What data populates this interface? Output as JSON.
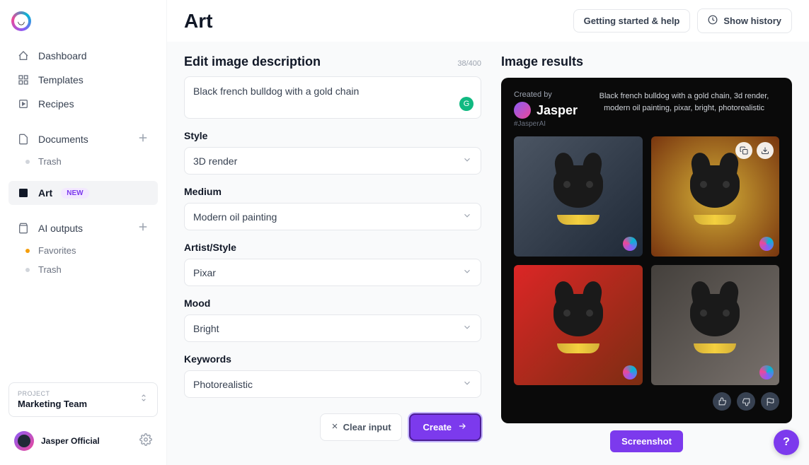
{
  "sidebar": {
    "nav": [
      {
        "label": "Dashboard",
        "icon": "home"
      },
      {
        "label": "Templates",
        "icon": "grid"
      },
      {
        "label": "Recipes",
        "icon": "play"
      }
    ],
    "documents_label": "Documents",
    "trash_label": "Trash",
    "art_label": "Art",
    "art_badge": "NEW",
    "ai_outputs_label": "AI outputs",
    "favorites_label": "Favorites",
    "project_label": "PROJECT",
    "project_name": "Marketing Team",
    "user_name": "Jasper Official"
  },
  "header": {
    "title": "Art",
    "getting_started": "Getting started & help",
    "show_history": "Show history"
  },
  "form": {
    "edit_label": "Edit image description",
    "counter": "38/400",
    "description": "Black french bulldog with a gold chain",
    "style_label": "Style",
    "style_value": "3D render",
    "medium_label": "Medium",
    "medium_value": "Modern oil painting",
    "artist_label": "Artist/Style",
    "artist_value": "Pixar",
    "mood_label": "Mood",
    "mood_value": "Bright",
    "keywords_label": "Keywords",
    "keywords_value": "Photorealistic",
    "clear_label": "Clear input",
    "create_label": "Create"
  },
  "results": {
    "title": "Image results",
    "created_by_label": "Created by",
    "author": "Jasper",
    "hashtag": "#JasperAI",
    "prompt": "Black french bulldog with a gold chain, 3d render, modern oil painting, pixar, bright, photorealistic",
    "screenshot_label": "Screenshot"
  },
  "help_label": "?"
}
